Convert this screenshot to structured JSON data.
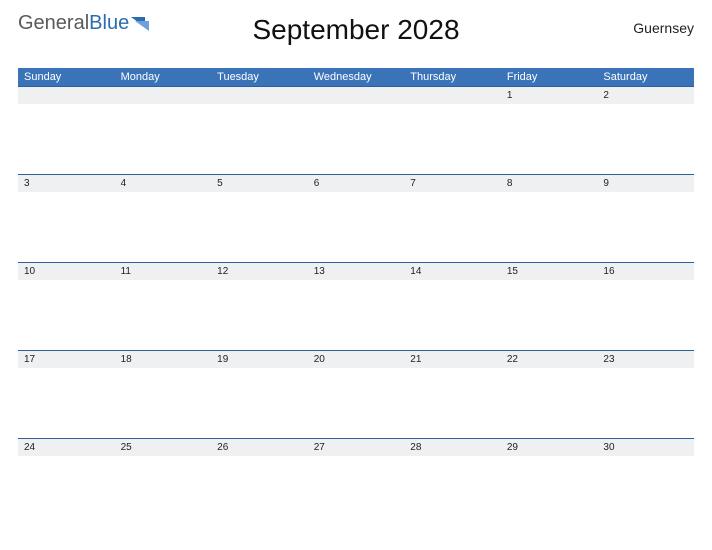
{
  "logo": {
    "part1": "General",
    "part2": "Blue"
  },
  "title": "September 2028",
  "region": "Guernsey",
  "day_names": [
    "Sunday",
    "Monday",
    "Tuesday",
    "Wednesday",
    "Thursday",
    "Friday",
    "Saturday"
  ],
  "weeks": [
    [
      "",
      "",
      "",
      "",
      "",
      "1",
      "2"
    ],
    [
      "3",
      "4",
      "5",
      "6",
      "7",
      "8",
      "9"
    ],
    [
      "10",
      "11",
      "12",
      "13",
      "14",
      "15",
      "16"
    ],
    [
      "17",
      "18",
      "19",
      "20",
      "21",
      "22",
      "23"
    ],
    [
      "24",
      "25",
      "26",
      "27",
      "28",
      "29",
      "30"
    ]
  ]
}
